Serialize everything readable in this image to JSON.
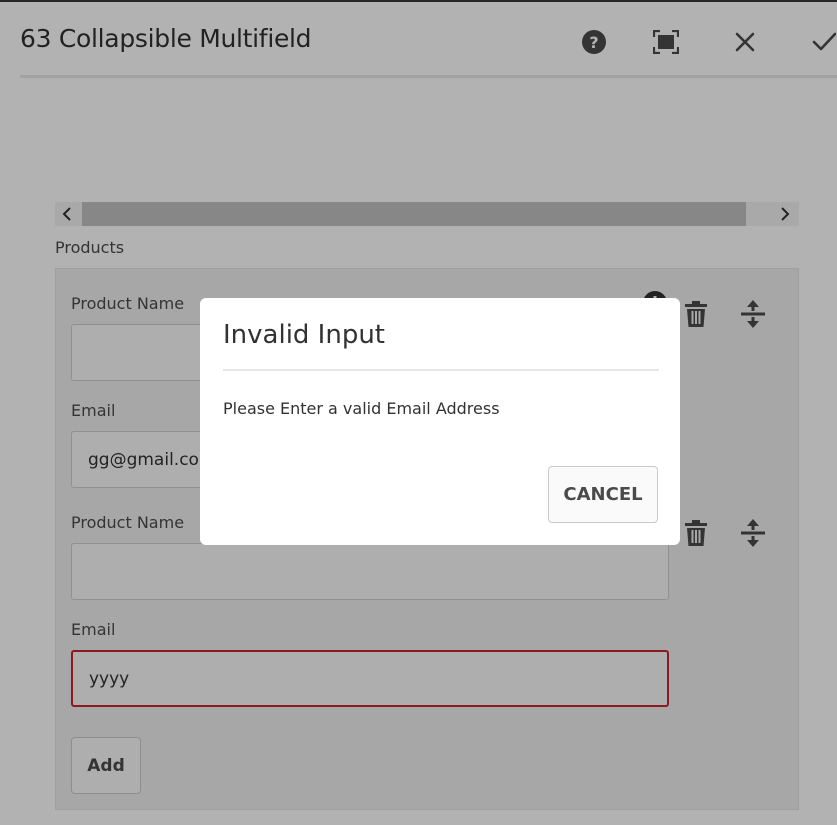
{
  "window": {
    "title": "63 Collapsible Multifield"
  },
  "header_icons": [
    "help-icon",
    "fullscreen-icon",
    "close-icon",
    "done-check-icon"
  ],
  "multifield": {
    "label": "Products",
    "items": [
      {
        "name_label": "Product Name",
        "name_value": "",
        "email_label": "Email",
        "email_value": "gg@gmail.com"
      },
      {
        "name_label": "Product Name",
        "name_value": "",
        "email_label": "Email",
        "email_value": "yyyy"
      }
    ],
    "add_label": "Add"
  },
  "dialog": {
    "title": "Invalid Input",
    "message": "Please Enter a valid Email Address",
    "cancel_label": "CANCEL"
  },
  "colors": {
    "error_border": "#c9252d",
    "overlay": "rgba(0,0,0,0.30)"
  }
}
